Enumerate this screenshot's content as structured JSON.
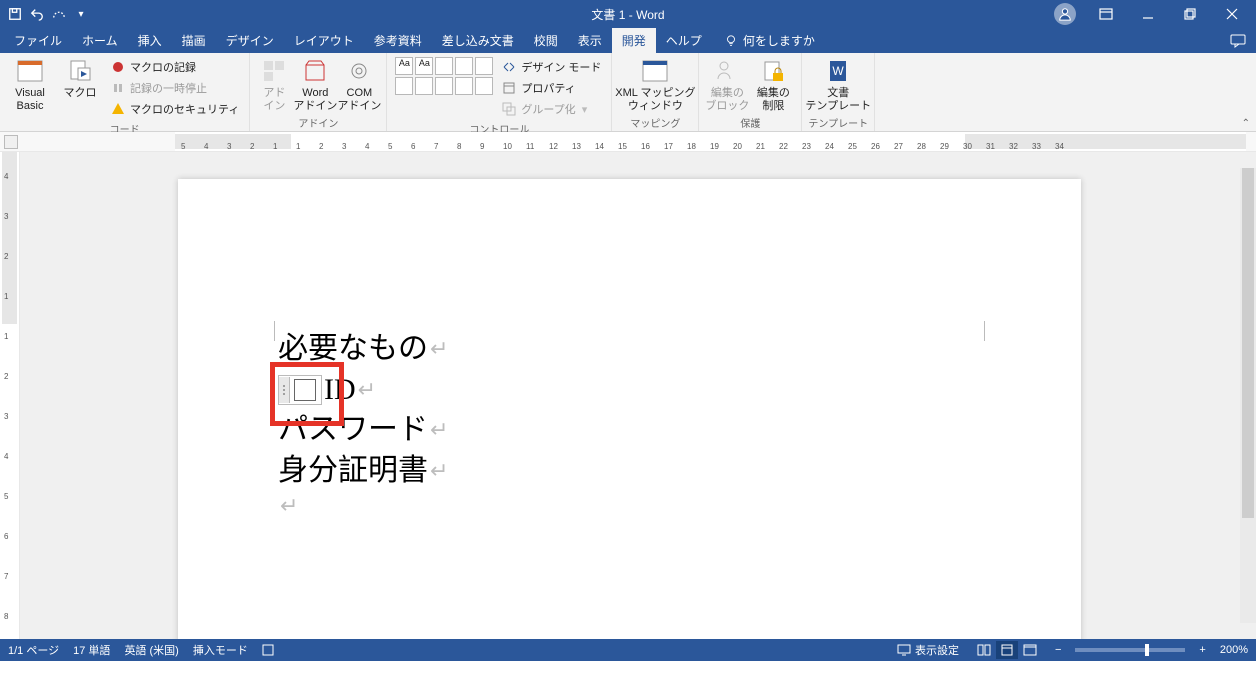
{
  "title": "文書 1  -  Word",
  "qat": {
    "save": "save",
    "undo": "undo",
    "redo": "redo",
    "customize": "customize"
  },
  "tabs": [
    "ファイル",
    "ホーム",
    "挿入",
    "描画",
    "デザイン",
    "レイアウト",
    "参考資料",
    "差し込み文書",
    "校閲",
    "表示",
    "開発",
    "ヘルプ"
  ],
  "active_tab": "開発",
  "tell_me": "何をしますか",
  "ribbon": {
    "code": {
      "label": "コード",
      "visual_basic": "Visual Basic",
      "macro": "マクロ",
      "record": "マクロの記録",
      "pause": "記録の一時停止",
      "security": "マクロのセキュリティ"
    },
    "addins": {
      "label": "アドイン",
      "addin": "アド\nイン",
      "word": "Word\nアドイン",
      "com": "COM\nアドイン"
    },
    "controls": {
      "label": "コントロール",
      "design": "デザイン モード",
      "props": "プロパティ",
      "group": "グループ化"
    },
    "mapping": {
      "label": "マッピング",
      "xml": "XML マッピング\nウィンドウ"
    },
    "protect": {
      "label": "保護",
      "block": "編集の\nブロック",
      "restrict": "編集の\n制限"
    },
    "template": {
      "label": "テンプレート",
      "doc": "文書\nテンプレート"
    }
  },
  "ruler_h": [
    5,
    4,
    3,
    2,
    1,
    1,
    2,
    3,
    4,
    5,
    6,
    7,
    8,
    9,
    10,
    11,
    12,
    13,
    14,
    15,
    16,
    17,
    18,
    19,
    20,
    21,
    22,
    23,
    24,
    25,
    26,
    27,
    28,
    29,
    30,
    31,
    32,
    33,
    34
  ],
  "ruler_v": [
    4,
    3,
    2,
    1,
    1,
    2,
    3,
    4,
    5,
    6,
    7,
    8
  ],
  "content": {
    "l1": "必要なもの",
    "l2": "ID",
    "l3": "パスワード",
    "l4": "身分証明書"
  },
  "status": {
    "page": "1/1 ページ",
    "words": "17 単語",
    "lang": "英語 (米国)",
    "mode": "挿入モード",
    "display": "表示設定",
    "zoom": "200%"
  }
}
